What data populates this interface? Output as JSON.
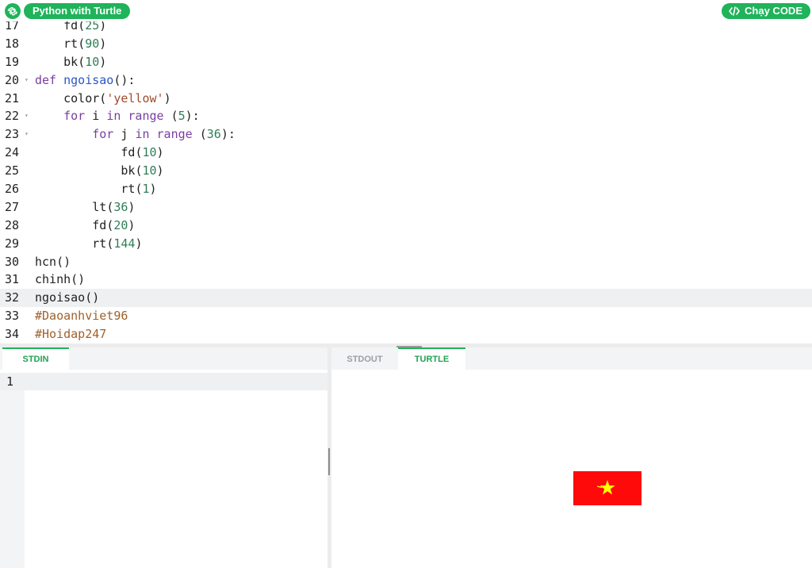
{
  "app": {
    "title": "Python with Turtle",
    "run_label": "Chạy CODE",
    "accent_color": "#1fb35a",
    "icons": {
      "settings": "gear-icon",
      "run": "code-icon"
    }
  },
  "editor": {
    "active_line": 32,
    "lines": [
      {
        "num": "17",
        "tokens": [
          {
            "t": "    "
          },
          {
            "t": "fd",
            "c": "plain"
          },
          {
            "t": "("
          },
          {
            "t": "25",
            "c": "num"
          },
          {
            "t": ")"
          }
        ]
      },
      {
        "num": "18",
        "tokens": [
          {
            "t": "    "
          },
          {
            "t": "rt",
            "c": "plain"
          },
          {
            "t": "("
          },
          {
            "t": "90",
            "c": "num"
          },
          {
            "t": ")"
          }
        ]
      },
      {
        "num": "19",
        "tokens": [
          {
            "t": "    "
          },
          {
            "t": "bk",
            "c": "plain"
          },
          {
            "t": "("
          },
          {
            "t": "10",
            "c": "num"
          },
          {
            "t": ")"
          }
        ]
      },
      {
        "num": "20",
        "fold": true,
        "tokens": [
          {
            "t": "def",
            "c": "kw"
          },
          {
            "t": " "
          },
          {
            "t": "ngoisao",
            "c": "fn"
          },
          {
            "t": "():"
          }
        ]
      },
      {
        "num": "21",
        "tokens": [
          {
            "t": "    "
          },
          {
            "t": "color"
          },
          {
            "t": "("
          },
          {
            "t": "'yellow'",
            "c": "str"
          },
          {
            "t": ")"
          }
        ]
      },
      {
        "num": "22",
        "fold": true,
        "tokens": [
          {
            "t": "    "
          },
          {
            "t": "for",
            "c": "kw"
          },
          {
            "t": " i "
          },
          {
            "t": "in",
            "c": "kw"
          },
          {
            "t": " "
          },
          {
            "t": "range",
            "c": "kw"
          },
          {
            "t": " ("
          },
          {
            "t": "5",
            "c": "num"
          },
          {
            "t": "):"
          }
        ]
      },
      {
        "num": "23",
        "fold": true,
        "tokens": [
          {
            "t": "        "
          },
          {
            "t": "for",
            "c": "kw"
          },
          {
            "t": " j "
          },
          {
            "t": "in",
            "c": "kw"
          },
          {
            "t": " "
          },
          {
            "t": "range",
            "c": "kw"
          },
          {
            "t": " ("
          },
          {
            "t": "36",
            "c": "num"
          },
          {
            "t": "):"
          }
        ]
      },
      {
        "num": "24",
        "tokens": [
          {
            "t": "            "
          },
          {
            "t": "fd"
          },
          {
            "t": "("
          },
          {
            "t": "10",
            "c": "num"
          },
          {
            "t": ")"
          }
        ]
      },
      {
        "num": "25",
        "tokens": [
          {
            "t": "            "
          },
          {
            "t": "bk"
          },
          {
            "t": "("
          },
          {
            "t": "10",
            "c": "num"
          },
          {
            "t": ")"
          }
        ]
      },
      {
        "num": "26",
        "tokens": [
          {
            "t": "            "
          },
          {
            "t": "rt"
          },
          {
            "t": "("
          },
          {
            "t": "1",
            "c": "num"
          },
          {
            "t": ")"
          }
        ]
      },
      {
        "num": "27",
        "tokens": [
          {
            "t": "        "
          },
          {
            "t": "lt"
          },
          {
            "t": "("
          },
          {
            "t": "36",
            "c": "num"
          },
          {
            "t": ")"
          }
        ]
      },
      {
        "num": "28",
        "tokens": [
          {
            "t": "        "
          },
          {
            "t": "fd"
          },
          {
            "t": "("
          },
          {
            "t": "20",
            "c": "num"
          },
          {
            "t": ")"
          }
        ]
      },
      {
        "num": "29",
        "tokens": [
          {
            "t": "        "
          },
          {
            "t": "rt"
          },
          {
            "t": "("
          },
          {
            "t": "144",
            "c": "num"
          },
          {
            "t": ")"
          }
        ]
      },
      {
        "num": "30",
        "tokens": [
          {
            "t": "hcn()"
          }
        ]
      },
      {
        "num": "31",
        "tokens": [
          {
            "t": "chinh()"
          }
        ]
      },
      {
        "num": "32",
        "tokens": [
          {
            "t": "ngoisao()"
          }
        ]
      },
      {
        "num": "33",
        "tokens": [
          {
            "t": "#Daoanhviet96",
            "c": "cmt"
          }
        ]
      },
      {
        "num": "34",
        "tokens": [
          {
            "t": "#Hoidap247",
            "c": "cmt"
          }
        ]
      }
    ]
  },
  "stdin": {
    "tab_label": "STDIN",
    "line_number": "1"
  },
  "output": {
    "tabs": [
      {
        "label": "STDOUT",
        "active": false
      },
      {
        "label": "TURTLE",
        "active": true
      }
    ]
  },
  "turtle": {
    "flag_color": "#ff0a0a",
    "star_color": "#ffff00"
  }
}
